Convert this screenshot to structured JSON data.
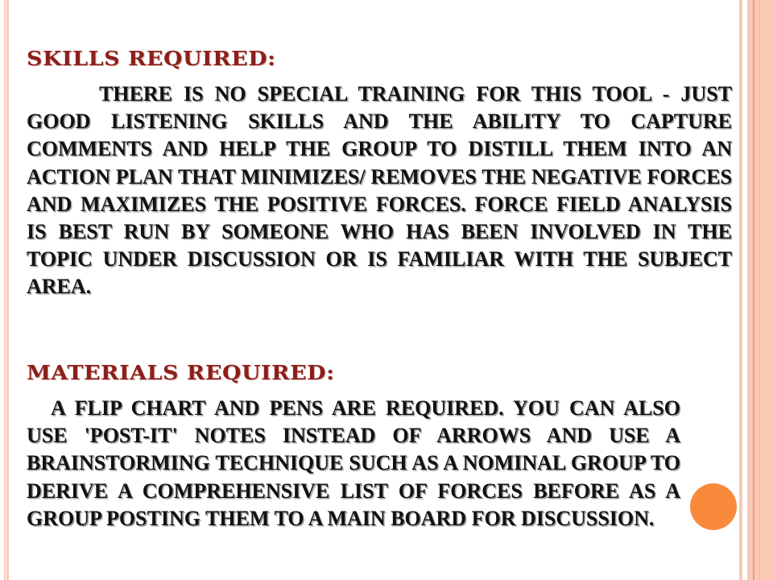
{
  "slide": {
    "sections": [
      {
        "heading": "Skills Required:",
        "body": "There is no special training for this tool - just good listening skills and the ability to capture comments and help the group to distill them into an action plan that minimizes/ removes the negative forces and maximizes the positive forces. Force Field Analysis is best run by someone who has been involved in the topic under discussion or is familiar with the subject area."
      },
      {
        "heading": "Materials Required:",
        "body": "A flip chart and pens are required. You can also use 'Post-it' notes instead of arrows and use a brainstorming technique such as a nominal group to derive a comprehensive list of forces before as a group posting them to a main board for discussion."
      }
    ],
    "colors": {
      "heading": "#8c1f1a",
      "body": "#111111",
      "border_stripe": "#f9c9b6",
      "accent_dot": "#f98a3c"
    },
    "decorations": {
      "accent_dot_icon": "orange-circle"
    }
  }
}
